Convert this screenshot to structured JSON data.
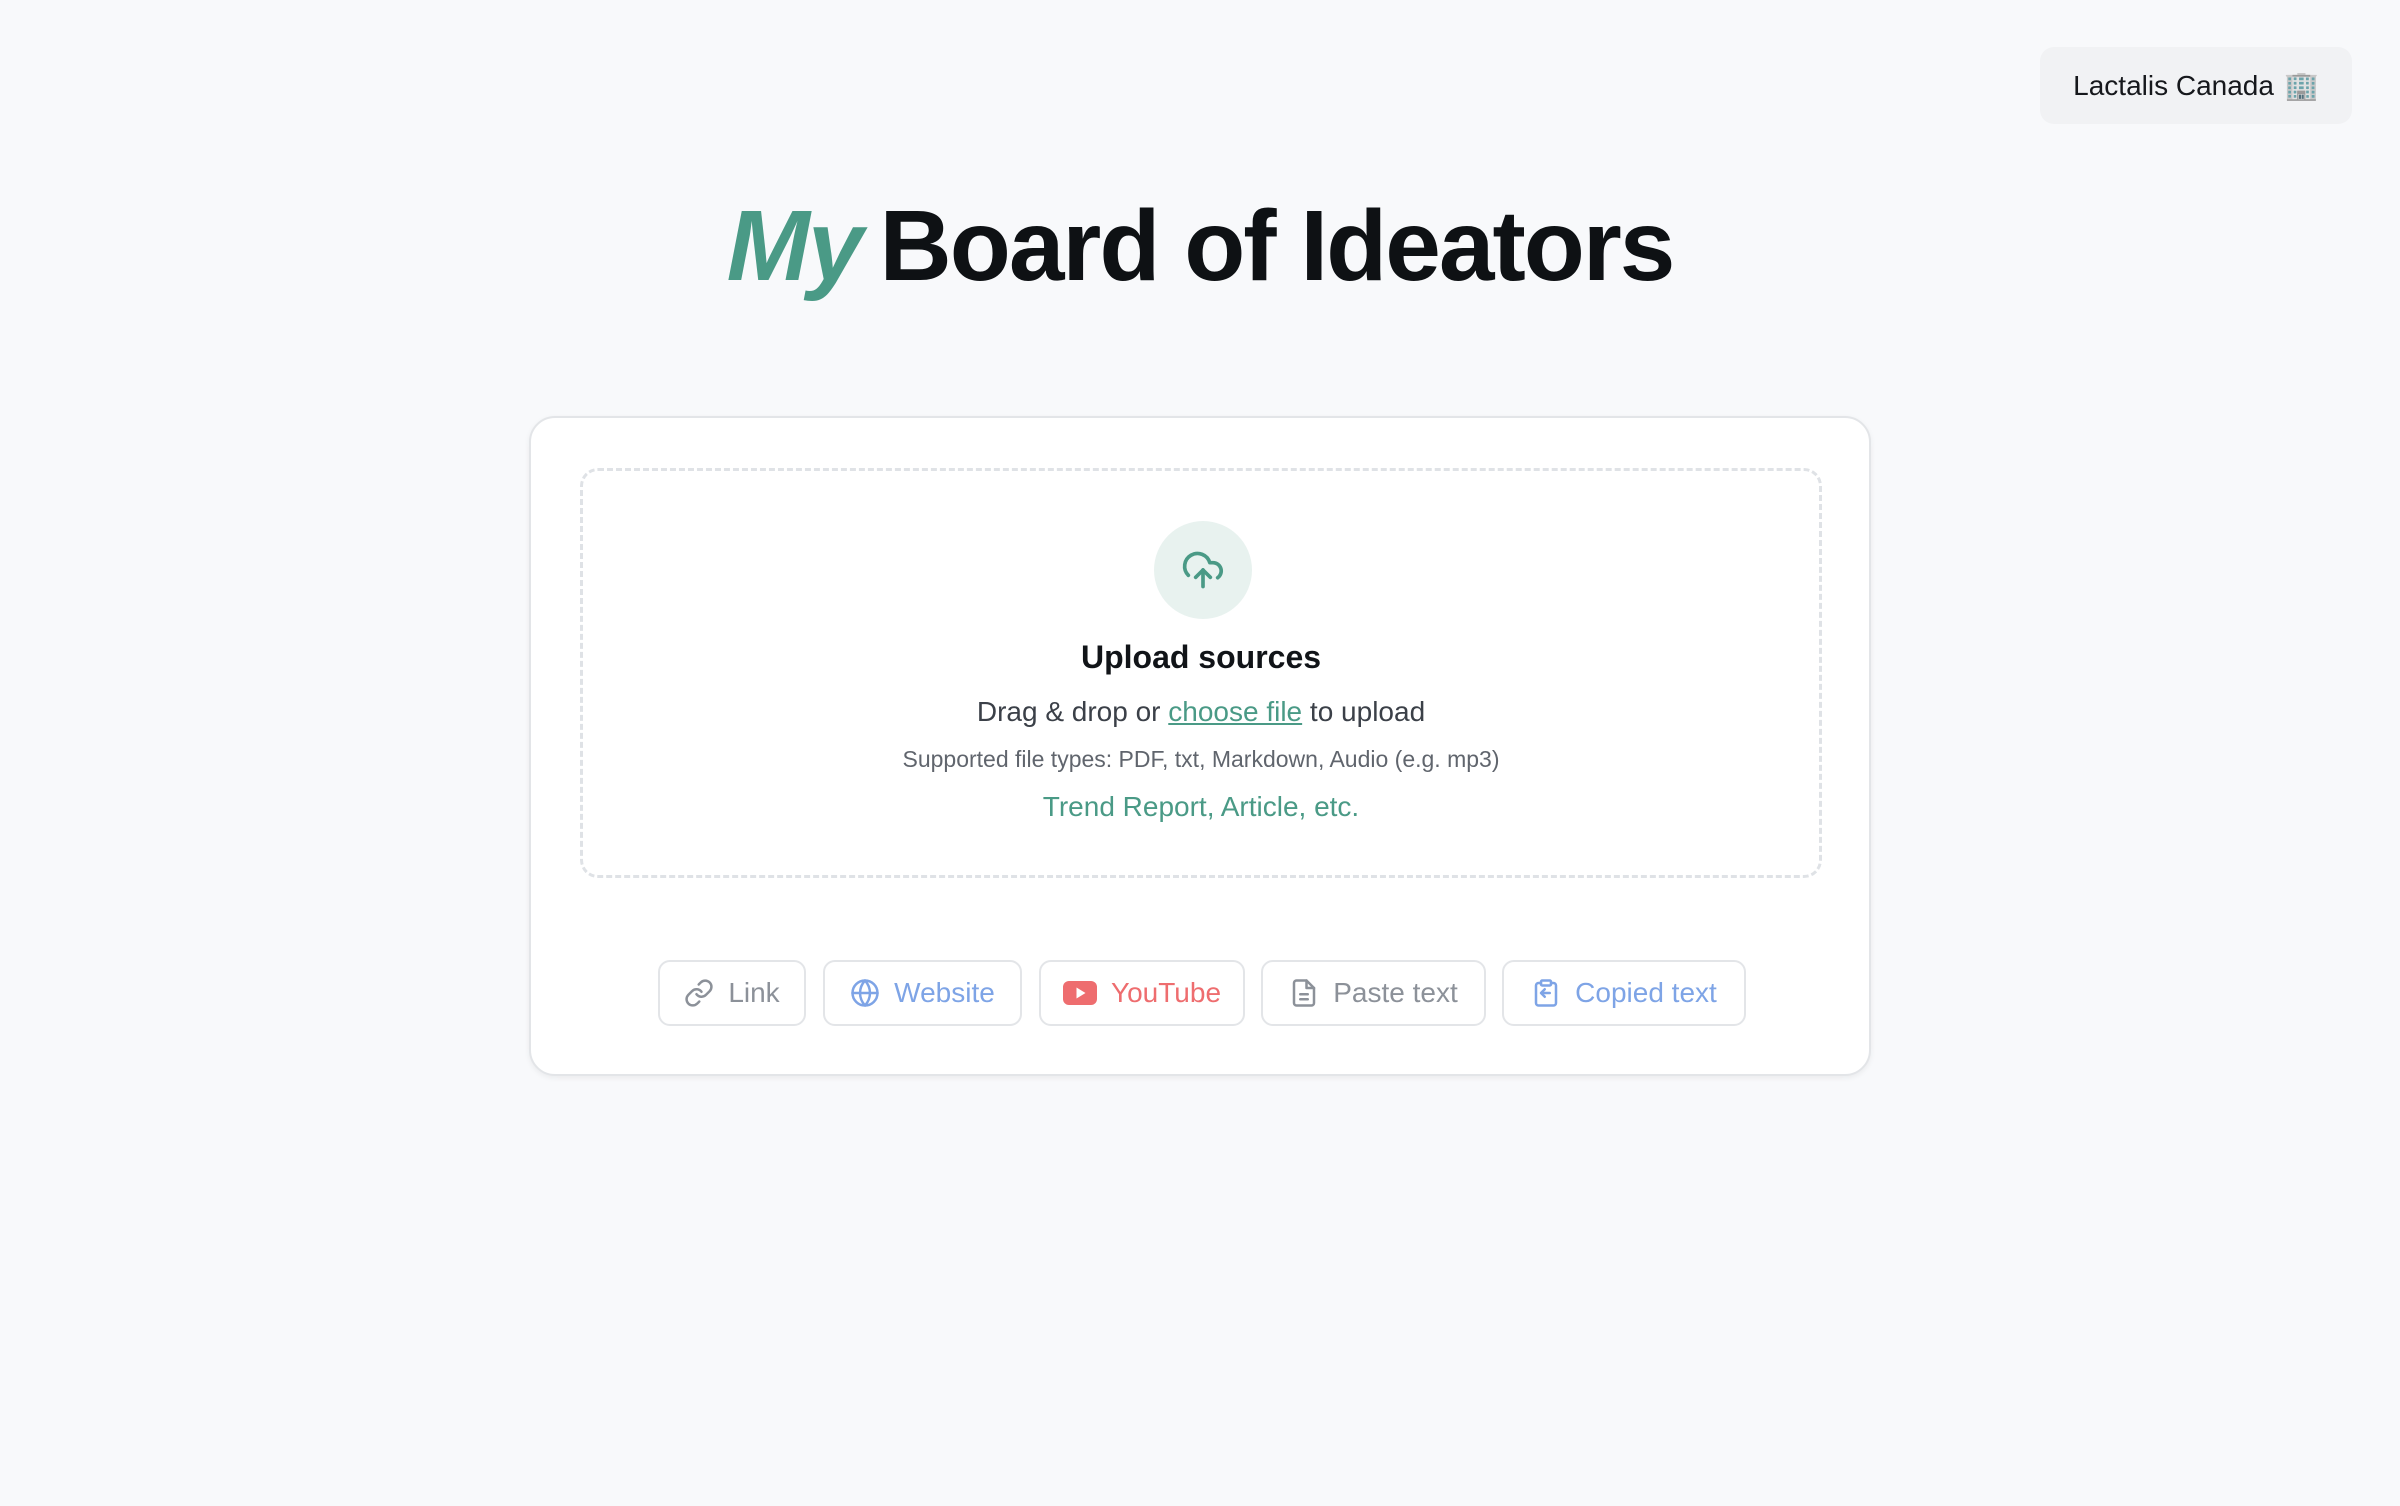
{
  "org": {
    "name": "Lactalis Canada",
    "emoji": "🏢"
  },
  "title": {
    "accent": "My",
    "rest": "Board of Ideators"
  },
  "upload": {
    "icon": "cloud-upload-icon",
    "title": "Upload sources",
    "prefix": "Drag & drop or",
    "link_text": "choose file",
    "suffix": "to upload",
    "supported": "Supported file types: PDF, txt, Markdown, Audio (e.g. mp3)",
    "examples": "Trend Report, Article, etc."
  },
  "sources": [
    {
      "label": "Link",
      "icon": "link-icon"
    },
    {
      "label": "Website",
      "icon": "globe-icon"
    },
    {
      "label": "YouTube",
      "icon": "youtube-icon"
    },
    {
      "label": "Paste text",
      "icon": "document-icon"
    },
    {
      "label": "Copied text",
      "icon": "clipboard-icon"
    }
  ],
  "colors": {
    "accent": "#4a9a86",
    "website": "#7ea4e6",
    "youtube": "#ee6d6f",
    "muted": "#8c9199",
    "background": "#f8f9fb"
  }
}
